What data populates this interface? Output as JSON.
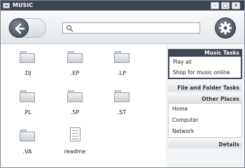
{
  "window": {
    "title": "MUSIC"
  },
  "title_controls": {
    "minimize": "–",
    "maximize": "□",
    "close": "✕"
  },
  "toolbar": {
    "search_placeholder": ""
  },
  "items": [
    {
      "name": ".DJ",
      "type": "folder"
    },
    {
      "name": ".EP",
      "type": "folder"
    },
    {
      "name": ".LP",
      "type": "folder"
    },
    {
      "name": ".PL",
      "type": "folder"
    },
    {
      "name": ".SP",
      "type": "folder"
    },
    {
      "name": ".ST",
      "type": "folder"
    },
    {
      "name": ".VA",
      "type": "folder"
    },
    {
      "name": "readme",
      "type": "document"
    }
  ],
  "side_panel": {
    "music_tasks": {
      "header": "Music Tasks",
      "items": [
        "Play all",
        "Shop for music online"
      ]
    },
    "file_folder_tasks": {
      "header": "File and Folder Tasks"
    },
    "other_places": {
      "header": "Other Places",
      "items": [
        "Home",
        "Computer",
        "Network"
      ]
    },
    "details": {
      "header": "Details"
    }
  },
  "colors": {
    "title_bar": "#3d4550",
    "panel_header_dark": "#3e4651",
    "panel_bg": "#f3f4f6"
  }
}
